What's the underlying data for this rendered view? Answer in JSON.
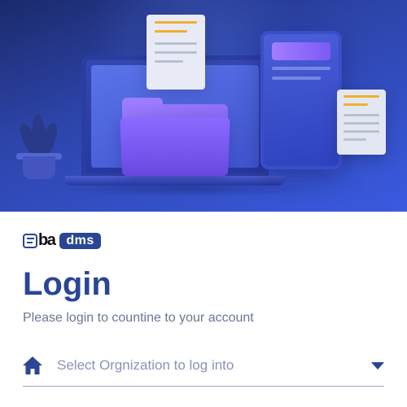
{
  "brand": {
    "part1": "eba",
    "part2": "dms"
  },
  "login": {
    "title": "Login",
    "subtitle": "Please login to countine to your account"
  },
  "org_select": {
    "placeholder": "Select Orgnization to log into"
  },
  "colors": {
    "primary": "#2a4694"
  }
}
